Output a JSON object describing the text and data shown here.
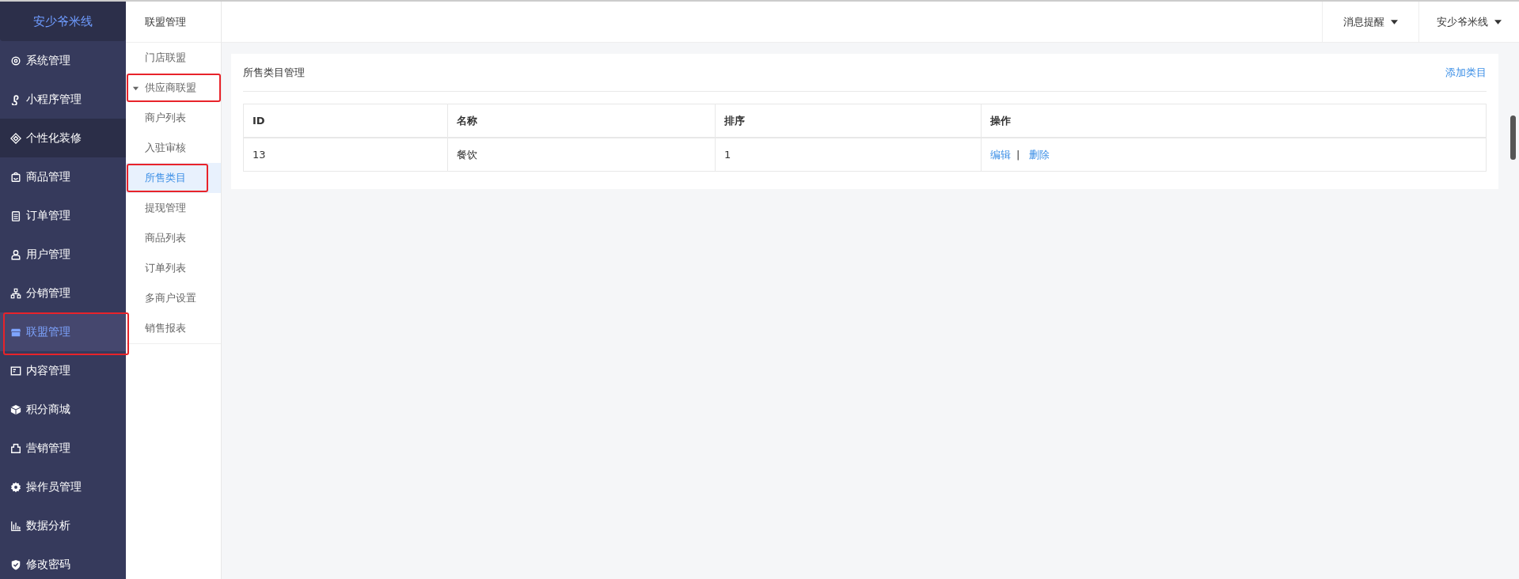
{
  "sidebar": {
    "logo": "安少爷米线",
    "items": [
      {
        "label": "系统管理",
        "selected": false,
        "hovered": false,
        "annotated": false
      },
      {
        "label": "小程序管理",
        "selected": false,
        "hovered": false,
        "annotated": false
      },
      {
        "label": "个性化装修",
        "selected": false,
        "hovered": true,
        "annotated": false
      },
      {
        "label": "商品管理",
        "selected": false,
        "hovered": false,
        "annotated": false
      },
      {
        "label": "订单管理",
        "selected": false,
        "hovered": false,
        "annotated": false
      },
      {
        "label": "用户管理",
        "selected": false,
        "hovered": false,
        "annotated": false
      },
      {
        "label": "分销管理",
        "selected": false,
        "hovered": false,
        "annotated": false
      },
      {
        "label": "联盟管理",
        "selected": true,
        "hovered": false,
        "annotated": true
      },
      {
        "label": "内容管理",
        "selected": false,
        "hovered": false,
        "annotated": false
      },
      {
        "label": "积分商城",
        "selected": false,
        "hovered": false,
        "annotated": false
      },
      {
        "label": "营销管理",
        "selected": false,
        "hovered": false,
        "annotated": false
      },
      {
        "label": "操作员管理",
        "selected": false,
        "hovered": false,
        "annotated": false
      },
      {
        "label": "数据分析",
        "selected": false,
        "hovered": false,
        "annotated": false
      },
      {
        "label": "修改密码",
        "selected": false,
        "hovered": false,
        "annotated": false
      }
    ]
  },
  "subnav": {
    "title": "联盟管理",
    "items": [
      {
        "label": "门店联盟",
        "selected": false,
        "annotated": false
      },
      {
        "label": "供应商联盟",
        "selected": false,
        "annotated": true,
        "expanded": true,
        "children": [
          {
            "label": "商户列表",
            "selected": false,
            "annotated": false
          },
          {
            "label": "入驻审核",
            "selected": false,
            "annotated": false
          },
          {
            "label": "所售类目",
            "selected": true,
            "annotated": true
          },
          {
            "label": "提现管理",
            "selected": false,
            "annotated": false
          },
          {
            "label": "商品列表",
            "selected": false,
            "annotated": false
          },
          {
            "label": "订单列表",
            "selected": false,
            "annotated": false
          },
          {
            "label": "多商户设置",
            "selected": false,
            "annotated": false
          },
          {
            "label": "销售报表",
            "selected": false,
            "annotated": false
          }
        ]
      }
    ]
  },
  "topbar": {
    "menus": [
      "消息提醒",
      "安少爷米线"
    ]
  },
  "panel": {
    "title": "所售类目管理",
    "action": "添加类目",
    "table": {
      "columns": [
        "ID",
        "名称",
        "排序",
        "操作"
      ],
      "rows": [
        {
          "id": "13",
          "name": "餐饮",
          "sort": "1",
          "actions": [
            "编辑",
            "删除"
          ],
          "separator": "|"
        }
      ]
    }
  }
}
